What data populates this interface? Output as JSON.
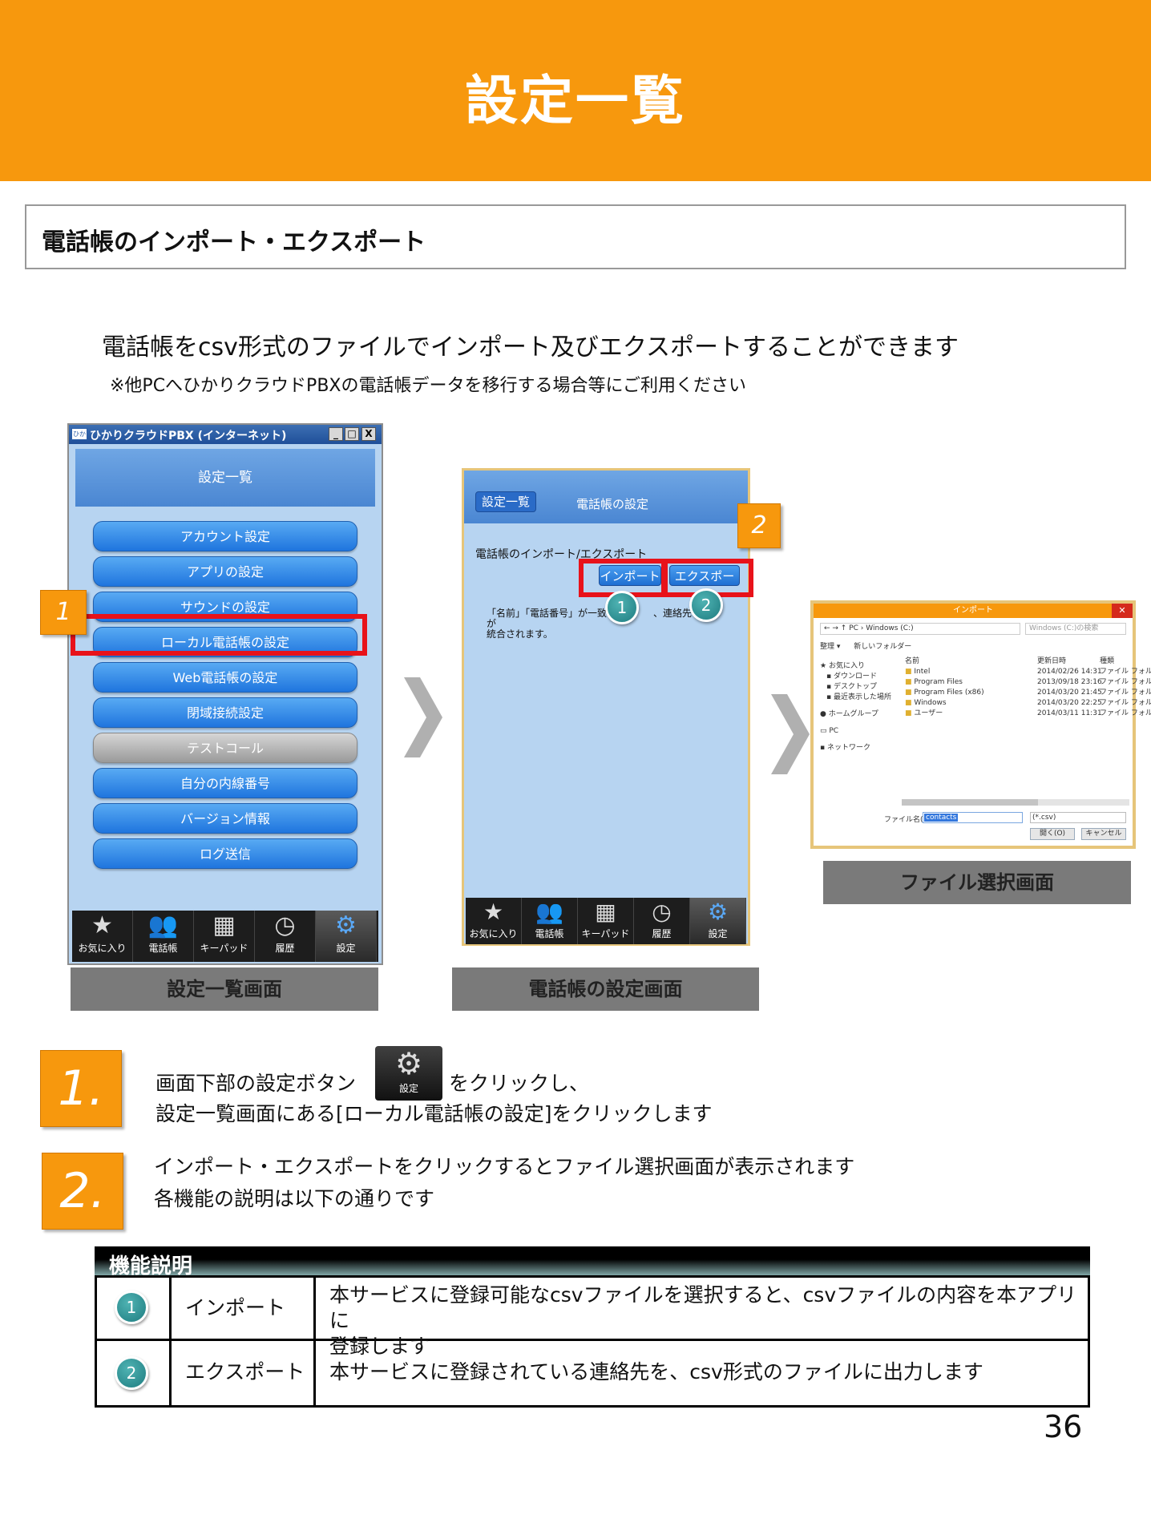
{
  "header": {
    "title": "設定一覧"
  },
  "section": {
    "title": "電話帳のインポート・エクスポート"
  },
  "intro": {
    "main": "電話帳をcsv形式のファイルでインポート及びエクスポートすることができます",
    "note": "※他PCへひかりクラウドPBXの電話帳データを移行する場合等にご利用ください"
  },
  "screen1": {
    "window_title": "ひかりクラウドPBX (インターネット)",
    "window_logo": "ひか",
    "window_controls": [
      "_",
      "□",
      "X"
    ],
    "header_title": "設定一覧",
    "items": [
      {
        "label": "アカウント設定"
      },
      {
        "label": "アプリの設定"
      },
      {
        "label": "サウンドの設定"
      },
      {
        "label": "ローカル電話帳の設定"
      },
      {
        "label": "Web電話帳の設定"
      },
      {
        "label": "閉域接続設定"
      },
      {
        "label": "テストコール"
      },
      {
        "label": "自分の内線番号"
      },
      {
        "label": "バージョン情報"
      },
      {
        "label": "ログ送信"
      }
    ],
    "tabbar": [
      {
        "label": "お気に入り",
        "icon": "star-icon"
      },
      {
        "label": "電話帳",
        "icon": "contacts-icon"
      },
      {
        "label": "キーパッド",
        "icon": "keypad-icon"
      },
      {
        "label": "履歴",
        "icon": "clock-icon"
      },
      {
        "label": "設定",
        "icon": "gear-icon"
      }
    ],
    "caption": "設定一覧画面",
    "tag": "1"
  },
  "screen2": {
    "back_button": "設定一覧",
    "header_title": "電話帳の設定",
    "row_label": "電話帳のインポート/エクスポート",
    "import_button": "インポート",
    "export_button": "エクスポート",
    "description_line1": "「名前」「電話番号」が一致し",
    "description_line1b": "、連絡先が",
    "description_line2": "統合されます。",
    "tabbar": [
      {
        "label": "お気に入り",
        "icon": "star-icon"
      },
      {
        "label": "電話帳",
        "icon": "contacts-icon"
      },
      {
        "label": "キーパッド",
        "icon": "keypad-icon"
      },
      {
        "label": "履歴",
        "icon": "clock-icon"
      },
      {
        "label": "設定",
        "icon": "gear-icon"
      }
    ],
    "caption": "電話帳の設定画面",
    "tag": "2",
    "marker1": "1",
    "marker2": "2"
  },
  "screen3": {
    "dialog_title": "インポート",
    "address": "← → ↑ PC › Windows (C:)",
    "search_placeholder": "Windows (C:)の検索",
    "toolbar_organize": "整理 ▾",
    "toolbar_new_folder": "新しいフォルダー",
    "sidebar": [
      "お気に入り",
      "ダウンロード",
      "デスクトップ",
      "最近表示した場所",
      "ホームグループ",
      "PC",
      "ネットワーク"
    ],
    "columns": {
      "name": "名前",
      "date": "更新日時",
      "type": "種類"
    },
    "files": [
      {
        "name": "Intel",
        "date": "2014/02/26 14:31",
        "type": "ファイル フォル"
      },
      {
        "name": "Program Files",
        "date": "2013/09/18 23:16",
        "type": "ファイル フォル"
      },
      {
        "name": "Program Files (x86)",
        "date": "2014/03/20 21:45",
        "type": "ファイル フォル"
      },
      {
        "name": "Windows",
        "date": "2014/03/20 22:25",
        "type": "ファイル フォル"
      },
      {
        "name": "ユーザー",
        "date": "2014/03/11 11:31",
        "type": "ファイル フォル"
      }
    ],
    "filename_label": "ファイル名(N):",
    "filename_value": "contacts",
    "filter": "(*.csv)",
    "open_button": "開く(O)",
    "cancel_button": "キャンセル",
    "caption": "ファイル選択画面"
  },
  "steps": [
    {
      "number": "1.",
      "line1_before": "画面下部の設定ボタン",
      "line1_after": "をクリックし、",
      "line2": "設定一覧画面にある[ローカル電話帳の設定]をクリックします",
      "gear_label": "設定"
    },
    {
      "number": "2.",
      "line1": "インポート・エクスポートをクリックするとファイル選択画面が表示されます",
      "line2": "各機能の説明は以下の通りです"
    }
  ],
  "table": {
    "title": "機能説明",
    "rows": [
      {
        "marker": "1",
        "name": "インポート",
        "desc_line1": "本サービスに登録可能なcsvファイルを選択すると、csvファイルの内容を本アプリに",
        "desc_line2": "登録します"
      },
      {
        "marker": "2",
        "name": "エクスポート",
        "desc_line1": "本サービスに登録されている連絡先を、csv形式のファイルに出力します"
      }
    ]
  },
  "page_number": "36",
  "colors": {
    "header_orange": "#f7980d",
    "highlight_red": "#e8121a",
    "button_blue": "#1f75de",
    "marker_teal": "#1e7c80"
  }
}
